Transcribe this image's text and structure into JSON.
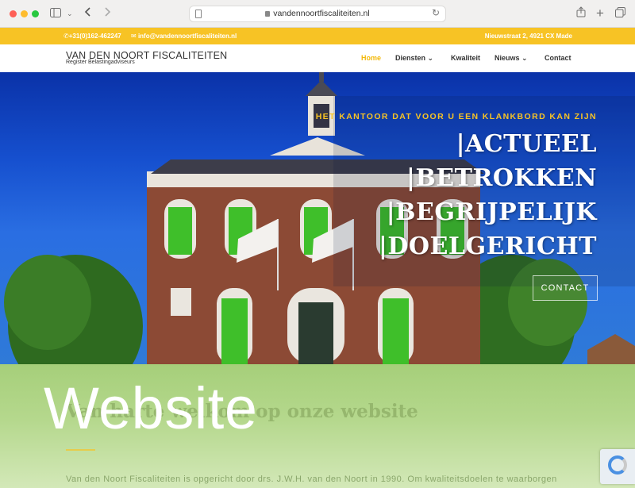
{
  "browser": {
    "url": "vandennoortfiscaliteiten.nl"
  },
  "topbar": {
    "phone": "+31(0)162-462247",
    "email": "info@vandennoortfiscaliteiten.nl",
    "address": "Nieuwstraat 2, 4921 CX Made"
  },
  "nav": {
    "logo_name": "VAN DEN NOORT FISCALITEITEN",
    "logo_sub": "Register Belastingadviseurs",
    "items": [
      {
        "label": "Home",
        "active": true
      },
      {
        "label": "Diensten ⌄"
      },
      {
        "label": "Kwaliteit"
      },
      {
        "label": "Nieuws ⌄"
      },
      {
        "label": "Contact"
      }
    ]
  },
  "hero": {
    "tagline": "HET KANTOOR DAT VOOR U EEN KLANKBORD KAN ZIJN",
    "words": [
      "|ACTUEEL",
      "|BETROKKEN",
      "|BEGRIJPELIJK",
      "|DOELGERICHT"
    ],
    "cta": "CONTACT"
  },
  "content": {
    "heading": "Van harte welkom op onze website",
    "paragraph": "Van den Noort Fiscaliteiten is opgericht door drs. J.W.H. van den Noort in 1990. Om kwaliteitsdoelen te waarborgen"
  },
  "overlay": {
    "label": "Website"
  },
  "colors": {
    "accent": "#f7c325",
    "overlay_green": "#a6cf7a"
  }
}
